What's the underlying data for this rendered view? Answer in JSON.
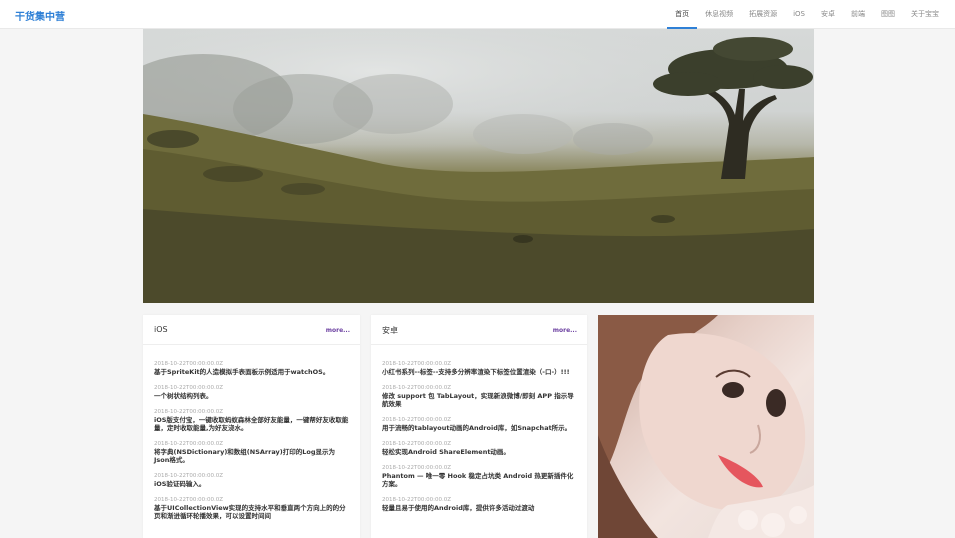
{
  "brand": "干货集中营",
  "nav": {
    "items": [
      {
        "label": "首页",
        "active": true
      },
      {
        "label": "休息视频",
        "active": false
      },
      {
        "label": "拓展资源",
        "active": false
      },
      {
        "label": "iOS",
        "active": false
      },
      {
        "label": "安卓",
        "active": false
      },
      {
        "label": "前端",
        "active": false
      },
      {
        "label": "图图",
        "active": false
      },
      {
        "label": "关于宝宝",
        "active": false
      }
    ]
  },
  "cards": [
    {
      "title": "iOS",
      "more": "more...",
      "items": [
        {
          "date": "2018-10-22T00:00:00.0Z",
          "title": "基于SpriteKit的人造模拟手表面板示例适用于watchOS。"
        },
        {
          "date": "2018-10-22T00:00:00.0Z",
          "title": "一个树状结构列表。"
        },
        {
          "date": "2018-10-22T00:00:00.0Z",
          "title": "iOS版支付宝，一键收取蚂蚁森林全部好友能量，一键帮好友收取能量，定时收取能量,为好友浇水。"
        },
        {
          "date": "2018-10-22T00:00:00.0Z",
          "title": "将字典(NSDictionary)和数组(NSArray)打印的Log显示为Json格式。"
        },
        {
          "date": "2018-10-22T00:00:00.0Z",
          "title": "iOS验证码输入。"
        },
        {
          "date": "2018-10-22T00:00:00.0Z",
          "title": "基于UICollectionView实现的支持水平和垂直两个方向上的的分页和渐进循环轮播效果，可以设置时间间"
        }
      ]
    },
    {
      "title": "安卓",
      "more": "more...",
      "items": [
        {
          "date": "2018-10-22T00:00:00.0Z",
          "title": "小红书系列--标签--支持多分辨率渲染下标签位置渲染（-口-）!!!"
        },
        {
          "date": "2018-10-22T00:00:00.0Z",
          "title": "修改 support 包 TabLayout，实现新浪微博/即刻 APP 指示导航效果"
        },
        {
          "date": "2018-10-22T00:00:00.0Z",
          "title": "用于流畅的tablayout动画的Android库，如Snapchat所示。"
        },
        {
          "date": "2018-10-22T00:00:00.0Z",
          "title": "轻松实现Android ShareElement动画。"
        },
        {
          "date": "2018-10-22T00:00:00.0Z",
          "title": "Phantom — 唯一零 Hook 稳定占坑类 Android 热更新插件化方案。"
        },
        {
          "date": "2018-10-22T00:00:00.0Z",
          "title": "轻量且易于使用的Android库，提供许多活动过渡动"
        }
      ]
    }
  ]
}
